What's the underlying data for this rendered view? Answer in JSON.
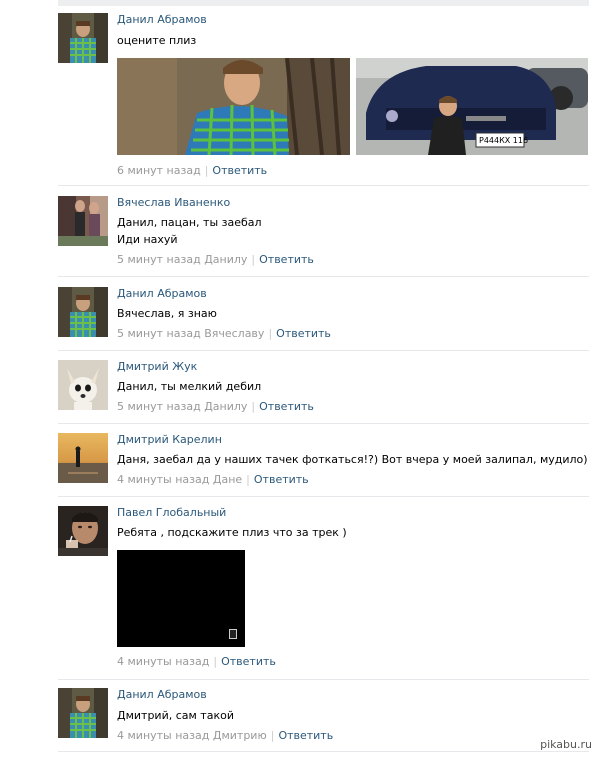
{
  "comments": [
    {
      "author": "Данил Абрамов",
      "text": [
        "оцените плиз"
      ],
      "time": "6 минут назад",
      "reply_to": "",
      "reply_label": "Ответить"
    },
    {
      "author": "Вячеслав Иваненко",
      "text": [
        "Данил, пацан, ты заебал",
        "Иди нахуй"
      ],
      "time": "5 минут назад",
      "reply_to": "Данилу",
      "reply_label": "Ответить"
    },
    {
      "author": "Данил Абрамов",
      "text": [
        "Вячеслав, я знаю"
      ],
      "time": "5 минут назад",
      "reply_to": "Вячеславу",
      "reply_label": "Ответить"
    },
    {
      "author": "Дмитрий Жук",
      "text": [
        "Данил, ты мелкий дебил"
      ],
      "time": "5 минут назад",
      "reply_to": "Данилу",
      "reply_label": "Ответить"
    },
    {
      "author": "Дмитрий Карелин",
      "text": [
        "Даня, заебал да у наших тачек фоткаться!?) Вот вчера у моей залипал, мудило)"
      ],
      "time": "4 минуты назад",
      "reply_to": "Дане",
      "reply_label": "Ответить"
    },
    {
      "author": "Павел Глобальный",
      "text": [
        "Ребята , подскажите плиз что за трек )"
      ],
      "time": "4 минуты назад",
      "reply_to": "",
      "reply_label": "Ответить"
    },
    {
      "author": "Данил Абрамов",
      "text": [
        "Дмитрий, сам такой"
      ],
      "time": "4 минуты назад",
      "reply_to": "Дмитрию",
      "reply_label": "Ответить"
    }
  ],
  "car_plate": "Р444КХ 116",
  "watermark": "pikabu.ru",
  "colors": {
    "link": "#2b587a",
    "meta": "#999999",
    "separator": "#e7e8ec"
  }
}
